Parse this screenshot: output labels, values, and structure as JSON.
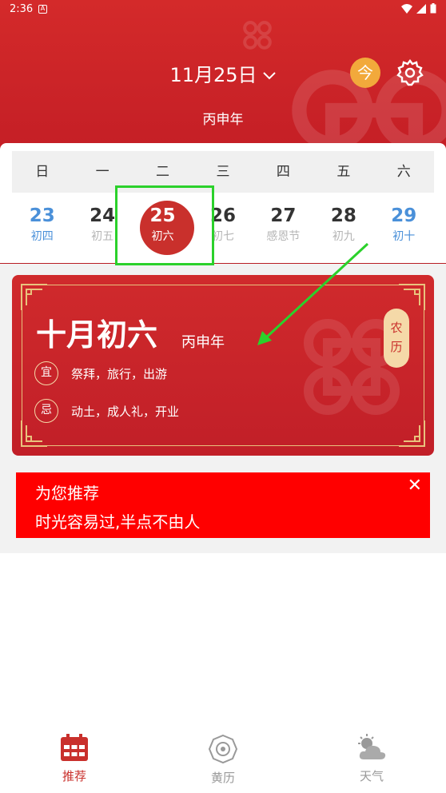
{
  "status_bar": {
    "time": "2:36"
  },
  "header": {
    "date_title": "11月25日",
    "today_label": "今",
    "year_label": "丙申年"
  },
  "week": {
    "headers": [
      "日",
      "一",
      "二",
      "三",
      "四",
      "五",
      "六"
    ],
    "days": [
      {
        "num": "23",
        "lunar": "初四"
      },
      {
        "num": "24",
        "lunar": "初五"
      },
      {
        "num": "25",
        "lunar": "初六"
      },
      {
        "num": "26",
        "lunar": "初七"
      },
      {
        "num": "27",
        "lunar": "感恩节"
      },
      {
        "num": "28",
        "lunar": "初九"
      },
      {
        "num": "29",
        "lunar": "初十"
      }
    ]
  },
  "almanac": {
    "title": "十月初六",
    "year": "丙申年",
    "toggle_top": "农",
    "toggle_bottom": "历",
    "good_badge": "宜",
    "good_text": "祭拜，旅行，出游",
    "bad_badge": "忌",
    "bad_text": "动土，成人礼，开业"
  },
  "banner": {
    "title": "为您推荐",
    "text": "时光容易过,半点不由人",
    "close": "✕"
  },
  "tabs": [
    {
      "label": "推荐"
    },
    {
      "label": "黄历"
    },
    {
      "label": "天气"
    }
  ],
  "colors": {
    "primary": "#c9302c",
    "accent": "#f2a93b",
    "weekend": "#4a90d9",
    "highlight": "#2bd12b"
  }
}
